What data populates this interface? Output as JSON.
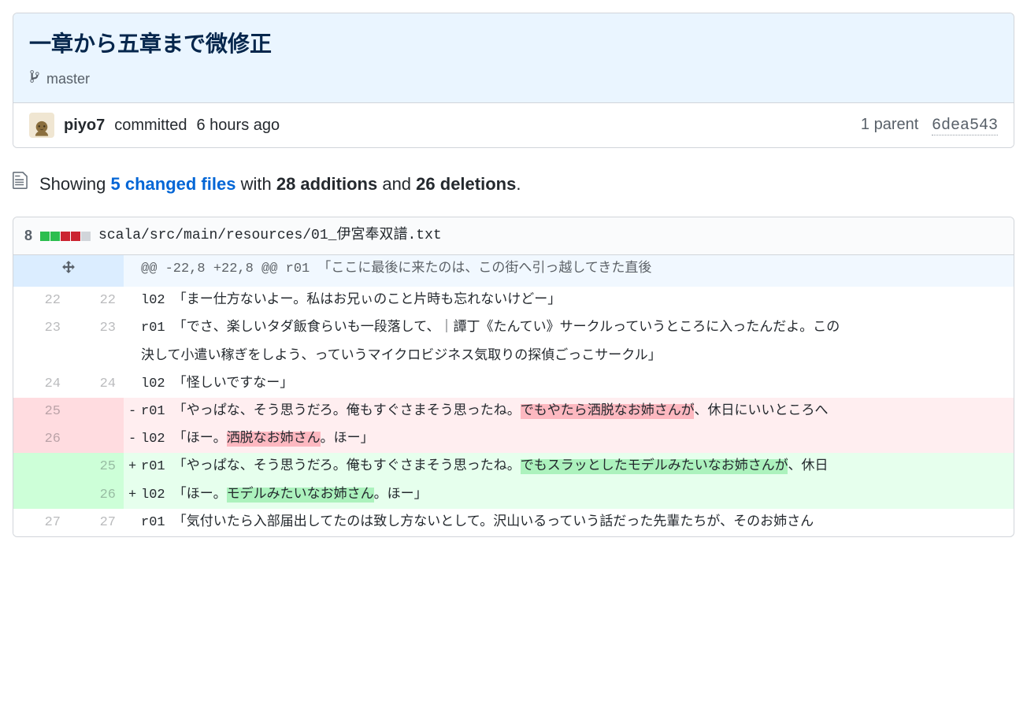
{
  "commit": {
    "title": "一章から五章まで微修正",
    "branch": "master",
    "author": "piyo7",
    "committed_text": "committed",
    "time_ago": "6 hours ago",
    "parent_count_label": "1 parent",
    "parent_sha": "6dea543"
  },
  "summary": {
    "showing": "Showing",
    "changed_files": "5 changed files",
    "with": "with",
    "additions": "28 additions",
    "and": "and",
    "deletions": "26 deletions",
    "period": "."
  },
  "file": {
    "change_count": "8",
    "path": "scala/src/main/resources/01_伊宮奉双譜.txt"
  },
  "hunk": {
    "header": "@@ -22,8 +22,8 @@ r01 「ここに最後に来たのは、この街へ引っ越してきた直後"
  },
  "lines": {
    "l1_old": "22",
    "l1_new": "22",
    "l1_text": "l02 「まー仕方ないよー。私はお兄ぃのこと片時も忘れないけどー」",
    "l2_old": "23",
    "l2_new": "23",
    "l2_text": "r01 「でさ、楽しいタダ飯食らいも一段落して、｜譚丁《たんてい》サークルっていうところに入ったんだよ。この",
    "l2b_text": "決して小遣い稼ぎをしよう、っていうマイクロビジネス気取りの探偵ごっこサークル」",
    "l3_old": "24",
    "l3_new": "24",
    "l3_text": "l02 「怪しいですなー」",
    "l4_old": "25",
    "l4_pre": "r01 「やっぱな、そう思うだろ。俺もすぐさまそう思ったね。",
    "l4_hl": "でもやたら洒脱なお姉さんが",
    "l4_post": "、休日にいいところへ",
    "l5_old": "26",
    "l5_pre": "l02 「ほー。",
    "l5_hl": "洒脱なお姉さん",
    "l5_post": "。ほー」",
    "l6_new": "25",
    "l6_pre": "r01 「やっぱな、そう思うだろ。俺もすぐさまそう思ったね。",
    "l6_hl": "でもスラッとしたモデルみたいなお姉さんが",
    "l6_post": "、休日",
    "l7_new": "26",
    "l7_pre": "l02 「ほー。",
    "l7_hl": "モデルみたいなお姉さん",
    "l7_post": "。ほー」",
    "l8_old": "27",
    "l8_new": "27",
    "l8_text": "r01 「気付いたら入部届出してたのは致し方ないとして。沢山いるっていう話だった先輩たちが、そのお姉さん"
  }
}
